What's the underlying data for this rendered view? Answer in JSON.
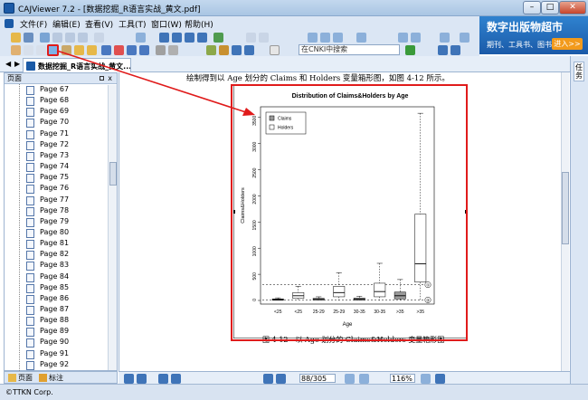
{
  "window": {
    "title": "CAJViewer 7.2 - [数据挖掘_R语言实战_黄文.pdf]"
  },
  "menu": [
    "文件(F)",
    "编辑(E)",
    "查看(V)",
    "工具(T)",
    "窗口(W)",
    "帮助(H)"
  ],
  "ad": {
    "title": "数字出版物超市",
    "subtitle": "期刊、工具书、图书…",
    "button": "进入>>"
  },
  "search": {
    "placeholder": "在CNKI中搜索"
  },
  "tab": {
    "label": "数据挖掘_R语言实战_黄文..."
  },
  "side_panel": {
    "title": "页面",
    "close_label": "x",
    "pages": [
      "Page 67",
      "Page 68",
      "Page 69",
      "Page 70",
      "Page 71",
      "Page 72",
      "Page 73",
      "Page 74",
      "Page 75",
      "Page 76",
      "Page 77",
      "Page 78",
      "Page 79",
      "Page 80",
      "Page 81",
      "Page 82",
      "Page 83",
      "Page 84",
      "Page 85",
      "Page 86",
      "Page 87",
      "Page 88",
      "Page 89",
      "Page 90",
      "Page 91",
      "Page 92"
    ],
    "bottom_tabs": [
      "页面",
      "标注"
    ]
  },
  "document": {
    "top_text": "绘制得到以 Age 划分的 Claims 和 Holders 变量箱形图，如图 4-12 所示。",
    "caption": "图 4-12　以 Age 划分的 Claims&Holders 变量箱形图"
  },
  "right_panel": {
    "label": "任务"
  },
  "status": {
    "page_value": "88/305",
    "zoom_value": "116%"
  },
  "bottom": {
    "copyright": "©TTKN Corp."
  },
  "chart_data": {
    "type": "boxplot",
    "title": "Distribution of Claims&Holders by Age",
    "xlabel": "Age",
    "ylabel": "Claims&Holders",
    "ylim": [
      0,
      3600
    ],
    "yticks": [
      0,
      500,
      1000,
      1500,
      2000,
      2500,
      3000,
      3500
    ],
    "categories": [
      "<25",
      "<25",
      "25-29",
      "25-29",
      "30-35",
      "30-35",
      ">35",
      ">35"
    ],
    "legend": [
      "Claims",
      "Holders"
    ],
    "legend_position": "top-left",
    "reference_lines": [
      {
        "value": 300,
        "label": "①"
      },
      {
        "value": 10,
        "label": "②"
      }
    ],
    "boxes": [
      {
        "category": "<25",
        "series": "Claims",
        "min": 0,
        "q1": 5,
        "median": 15,
        "q3": 30,
        "max": 50
      },
      {
        "category": "<25",
        "series": "Holders",
        "min": 0,
        "q1": 40,
        "median": 90,
        "q3": 150,
        "max": 270
      },
      {
        "category": "25-29",
        "series": "Claims",
        "min": 0,
        "q1": 8,
        "median": 20,
        "q3": 40,
        "max": 70
      },
      {
        "category": "25-29",
        "series": "Holders",
        "min": 0,
        "q1": 70,
        "median": 150,
        "q3": 270,
        "max": 530
      },
      {
        "category": "30-35",
        "series": "Claims",
        "min": 0,
        "q1": 8,
        "median": 20,
        "q3": 45,
        "max": 80
      },
      {
        "category": "30-35",
        "series": "Holders",
        "min": 0,
        "q1": 70,
        "median": 170,
        "q3": 330,
        "max": 710
      },
      {
        "category": ">35",
        "series": "Claims",
        "min": 0,
        "q1": 30,
        "median": 90,
        "q3": 160,
        "max": 400
      },
      {
        "category": ">35",
        "series": "Holders",
        "min": 0,
        "q1": 350,
        "median": 700,
        "q3": 1650,
        "max": 3580
      }
    ]
  },
  "colors": {
    "annotation": "#e01b1b",
    "chrome": "#dbe6f4",
    "accent": "#1b5aa8"
  }
}
